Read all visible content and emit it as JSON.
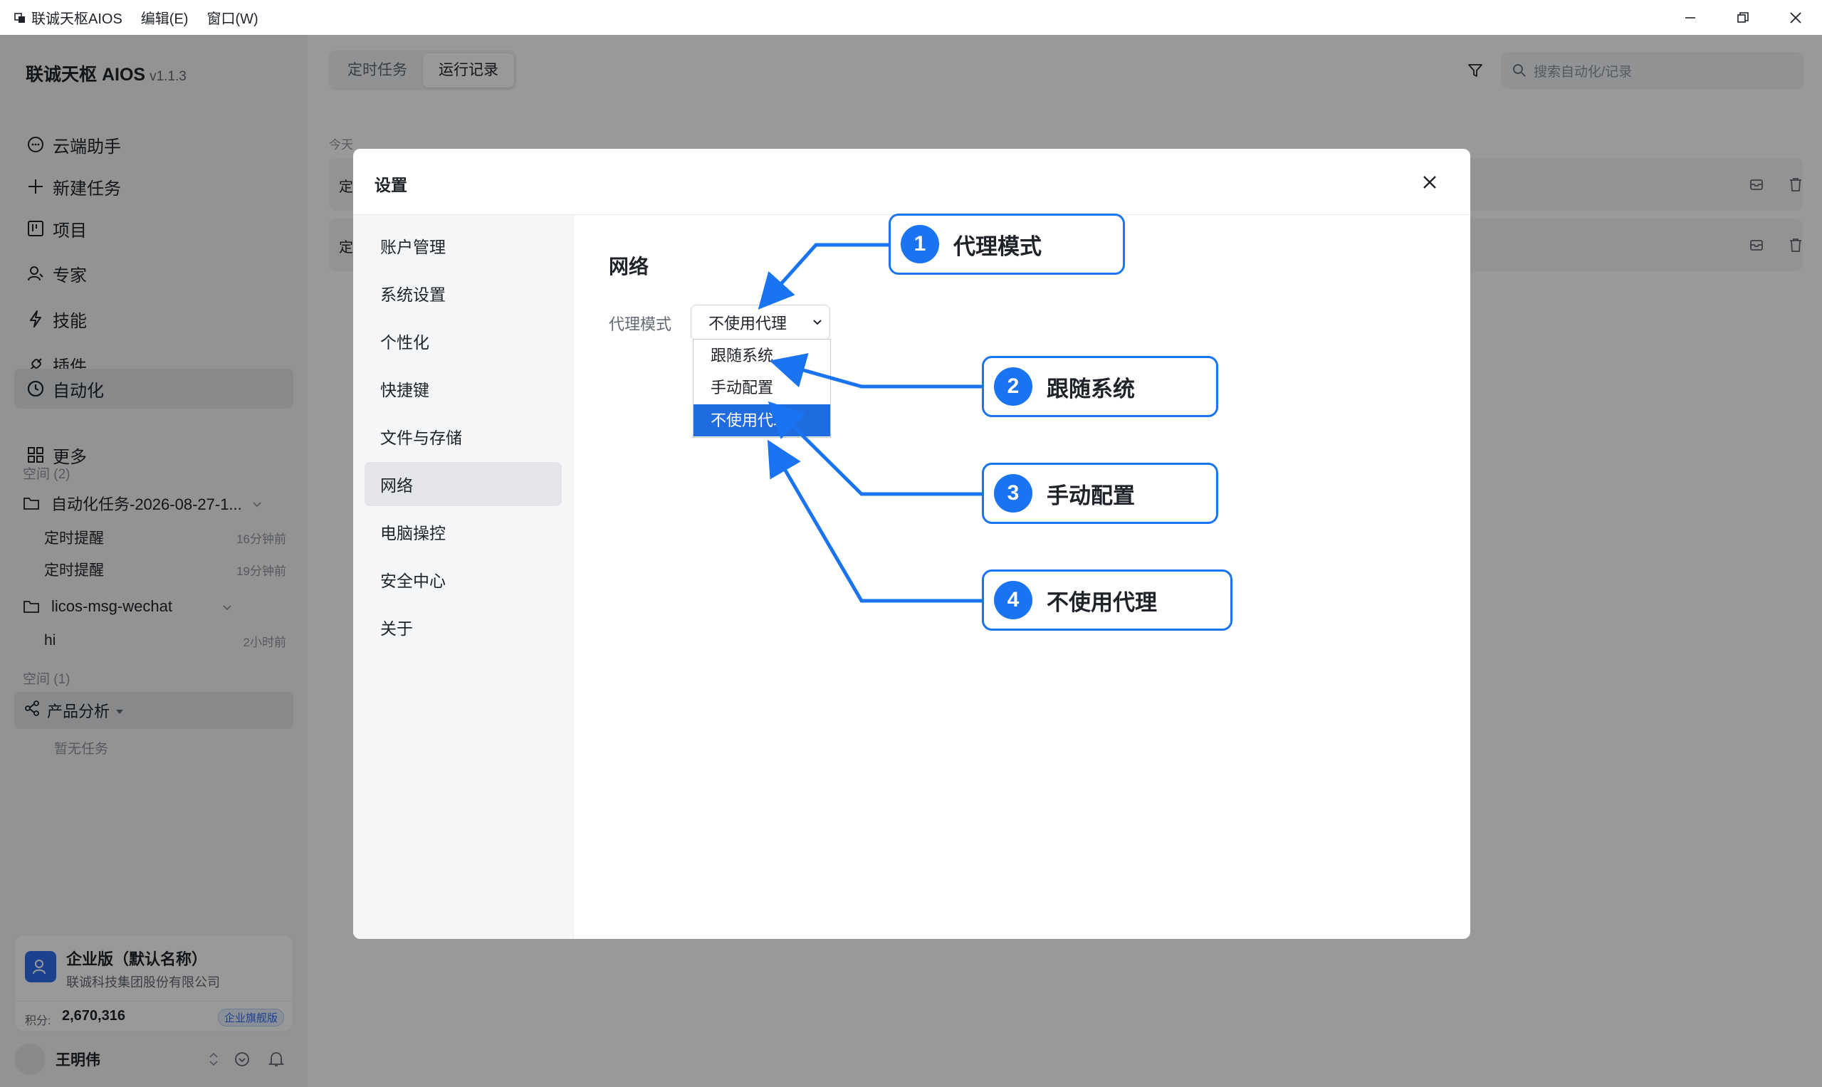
{
  "titlebar": {
    "app_name": "联诚天枢AIOS",
    "menus": [
      "编辑(E)",
      "窗口(W)"
    ]
  },
  "sidebar": {
    "brand": "联诚天枢 AIOS",
    "version": "v1.1.3",
    "nav": [
      {
        "label": "云端助手",
        "icon": "chat-icon"
      },
      {
        "label": "新建任务",
        "icon": "plus-icon"
      },
      {
        "label": "项目",
        "icon": "kanban-icon"
      },
      {
        "label": "专家",
        "icon": "expert-icon"
      },
      {
        "label": "技能",
        "icon": "lightning-icon"
      },
      {
        "label": "插件",
        "icon": "plugin-icon"
      },
      {
        "label": "自动化",
        "icon": "clock-icon"
      },
      {
        "label": "更多",
        "icon": "grid-icon"
      }
    ],
    "space1_label": "空间 (2)",
    "folder1": "自动化任务-2026-08-27-1...",
    "folder1_items": [
      {
        "name": "定时提醒",
        "time": "16分钟前"
      },
      {
        "name": "定时提醒",
        "time": "19分钟前"
      }
    ],
    "folder2": "licos-msg-wechat",
    "folder2_items": [
      {
        "name": "hi",
        "time": "2小时前"
      }
    ],
    "space2_label": "空间 (1)",
    "group": "产品分析",
    "group_empty": "暂无任务"
  },
  "org": {
    "name": "企业版（默认名称）",
    "company": "联诚科技集团股份有限公司",
    "points_label": "积分:",
    "points": "2,670,316",
    "badge": "企业旗舰版"
  },
  "user": {
    "name": "王明伟"
  },
  "main": {
    "tabs": [
      "定时任务",
      "运行记录"
    ],
    "active_tab": "运行记录",
    "search_placeholder": "搜索自动化/记录",
    "today_label": "今天",
    "records": [
      {
        "title_visible": "定"
      },
      {
        "title_visible": "定"
      }
    ]
  },
  "modal": {
    "title": "设置",
    "nav": [
      "账户管理",
      "系统设置",
      "个性化",
      "快捷键",
      "文件与存储",
      "网络",
      "电脑操控",
      "安全中心",
      "关于"
    ],
    "active_nav": "网络",
    "section_title": "网络",
    "proxy_label": "代理模式",
    "proxy_value": "不使用代理",
    "proxy_options": [
      "跟随系统",
      "手动配置",
      "不使用代理"
    ]
  },
  "callouts": [
    {
      "num": "1",
      "text": "代理模式"
    },
    {
      "num": "2",
      "text": "跟随系统"
    },
    {
      "num": "3",
      "text": "手动配置"
    },
    {
      "num": "4",
      "text": "不使用代理"
    }
  ],
  "colors": {
    "accent": "#1a73f0",
    "selected_option": "#1f6be0",
    "overlay": "rgba(0,0,0,0.4)"
  }
}
